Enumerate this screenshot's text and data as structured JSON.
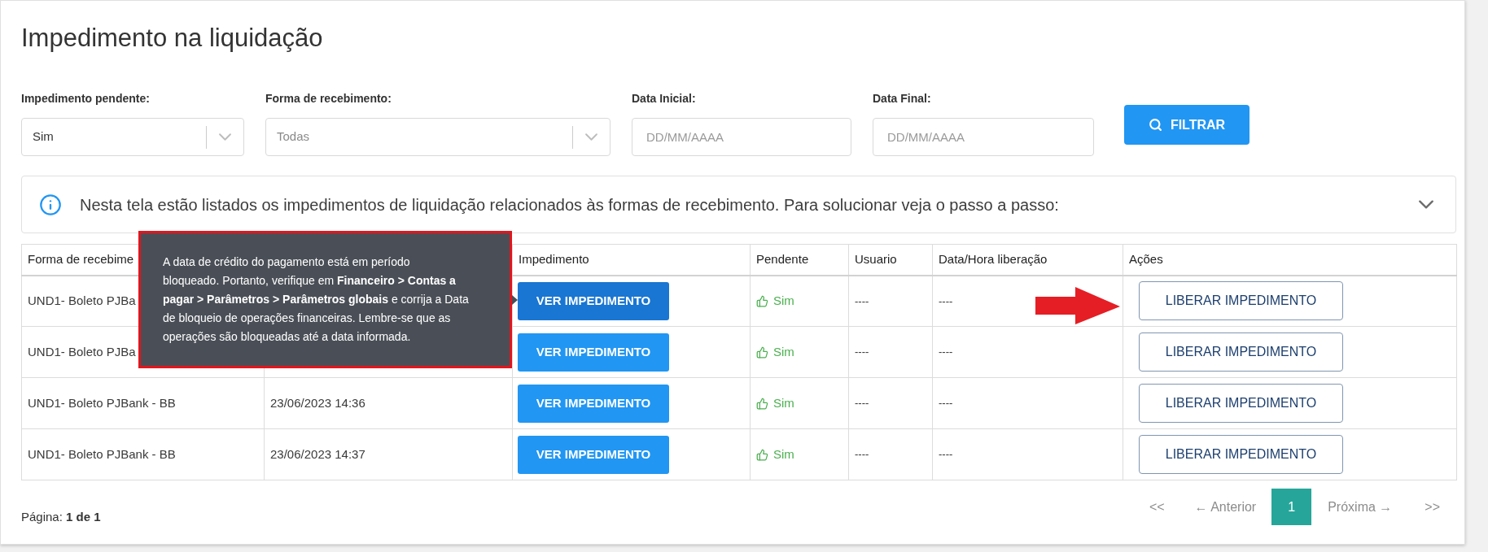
{
  "page": {
    "title": "Impedimento na liquidação"
  },
  "filters": [
    {
      "kind": "select",
      "label": "Impedimento pendente:",
      "value": "Sim"
    },
    {
      "kind": "select",
      "label": "Forma de recebimento:",
      "placeholder": "Todas"
    },
    {
      "kind": "date",
      "label": "Data Inicial:",
      "placeholder": "DD/MM/AAAA"
    },
    {
      "kind": "date",
      "label": "Data Final:",
      "placeholder": "DD/MM/AAAA"
    }
  ],
  "filter_button": {
    "label": "FILTRAR"
  },
  "info_banner": {
    "text": "Nesta tela estão listados os impedimentos de liquidação relacionados às formas de recebimento. Para solucionar veja o passo a passo:",
    "expanded": false
  },
  "table": {
    "columns": [
      {
        "label": "Forma de recebime"
      },
      null,
      {
        "label": "Impedimento"
      },
      {
        "label": "Pendente"
      },
      {
        "label": "Usuario"
      },
      {
        "label": "Data/Hora liberação"
      },
      {
        "label": "Ações"
      }
    ],
    "rows": [
      {
        "forma_de_recebimento": "UND1- Boleto PJBa",
        "impedimento": {
          "label": "VER IMPEDIMENTO",
          "hovered": true
        },
        "pendente": "Sim",
        "usuario": "----",
        "data_hora_liberacao": "----",
        "acao": "LIBERAR IMPEDIMENTO"
      },
      {
        "forma_de_recebimento": "UND1- Boleto PJBa",
        "impedimento": {
          "label": "VER IMPEDIMENTO",
          "hovered": false
        },
        "pendente": "Sim",
        "usuario": "----",
        "data_hora_liberacao": "----",
        "acao": "LIBERAR IMPEDIMENTO"
      },
      {
        "forma_de_recebimento": "UND1- Boleto PJBank - BB",
        "column_2": "23/06/2023 14:36",
        "impedimento": {
          "label": "VER IMPEDIMENTO",
          "hovered": false
        },
        "pendente": "Sim",
        "usuario": "----",
        "data_hora_liberacao": "----",
        "acao": "LIBERAR IMPEDIMENTO"
      },
      {
        "forma_de_recebimento": "UND1- Boleto PJBank - BB",
        "column_2": "23/06/2023 14:37",
        "impedimento": {
          "label": "VER IMPEDIMENTO",
          "hovered": false
        },
        "pendente": "Sim",
        "usuario": "----",
        "data_hora_liberacao": "----",
        "acao": "LIBERAR IMPEDIMENTO"
      }
    ]
  },
  "tooltip": {
    "lines": [
      "A data de crédito do pagamento está em período",
      "bloqueado. Portanto, verifique em **Financeiro > Contas a**",
      "**pagar > Parâmetros > Parâmetros globais** e corrija a Data",
      "de bloqueio de operações financeiras. Lembre-se que as",
      "operações são bloqueadas até a data informada."
    ]
  },
  "footer": {
    "page_info": "Página: **1 de 1**"
  },
  "pagination": {
    "first": "<<",
    "previous": "← Anterior",
    "pages": [
      {
        "label": "1",
        "selected": true
      }
    ],
    "next": "Próxima →",
    "last": ">>"
  }
}
